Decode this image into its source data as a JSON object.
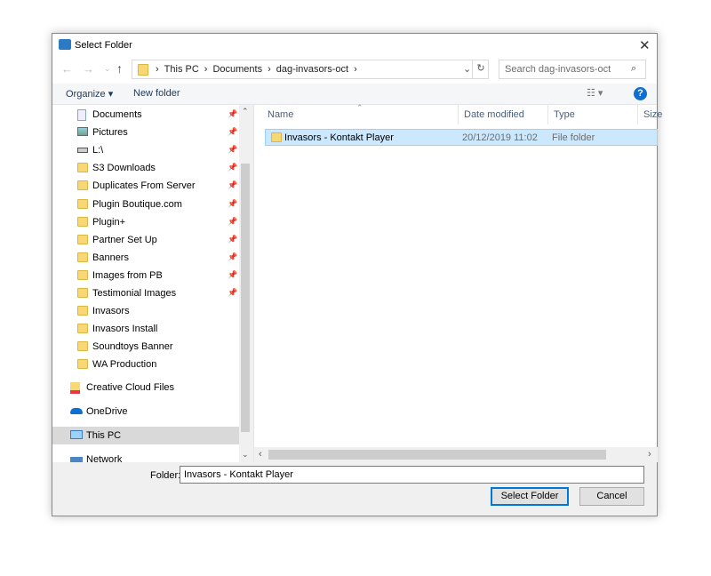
{
  "window": {
    "title": "Select Folder",
    "close": "✕"
  },
  "address": {
    "crumbs": [
      "This PC",
      "Documents",
      "dag-invasors-oct"
    ],
    "sep": "›",
    "search_placeholder": "Search dag-invasors-oct"
  },
  "toolbar": {
    "organize": "Organize ▾",
    "new_folder": "New folder",
    "help": "?"
  },
  "nav_items": [
    {
      "label": "Documents",
      "icon": "document-icon",
      "pinned": true
    },
    {
      "label": "Pictures",
      "icon": "pictures-icon",
      "pinned": true
    },
    {
      "label": "L:\\",
      "icon": "drive-icon",
      "pinned": true
    },
    {
      "label": "S3 Downloads",
      "icon": "folder-icon",
      "pinned": true
    },
    {
      "label": "Duplicates From Server",
      "icon": "folder-icon",
      "pinned": true
    },
    {
      "label": "Plugin Boutique.com",
      "icon": "folder-icon",
      "pinned": true
    },
    {
      "label": "Plugin+",
      "icon": "folder-icon",
      "pinned": true
    },
    {
      "label": "Partner Set Up",
      "icon": "folder-icon",
      "pinned": true
    },
    {
      "label": "Banners",
      "icon": "folder-icon",
      "pinned": true
    },
    {
      "label": "Images from PB",
      "icon": "folder-icon",
      "pinned": true
    },
    {
      "label": "Testimonial Images",
      "icon": "folder-icon",
      "pinned": true
    },
    {
      "label": "Invasors",
      "icon": "folder-icon",
      "pinned": false
    },
    {
      "label": "Invasors Install",
      "icon": "folder-icon",
      "pinned": false
    },
    {
      "label": "Soundtoys Banner",
      "icon": "folder-icon",
      "pinned": false
    },
    {
      "label": "WA Production",
      "icon": "folder-icon",
      "pinned": false
    }
  ],
  "nav_roots": [
    {
      "label": "Creative Cloud Files"
    },
    {
      "label": "OneDrive"
    },
    {
      "label": "This PC"
    },
    {
      "label": "Network"
    }
  ],
  "columns": [
    "Name",
    "Date modified",
    "Type",
    "Size"
  ],
  "files": [
    {
      "name": "Invasors - Kontakt Player",
      "date": "20/12/2019 11:02",
      "type": "File folder"
    }
  ],
  "footer": {
    "folder_label": "Folder:",
    "folder_value": "Invasors - Kontakt Player",
    "select": "Select Folder",
    "cancel": "Cancel"
  }
}
